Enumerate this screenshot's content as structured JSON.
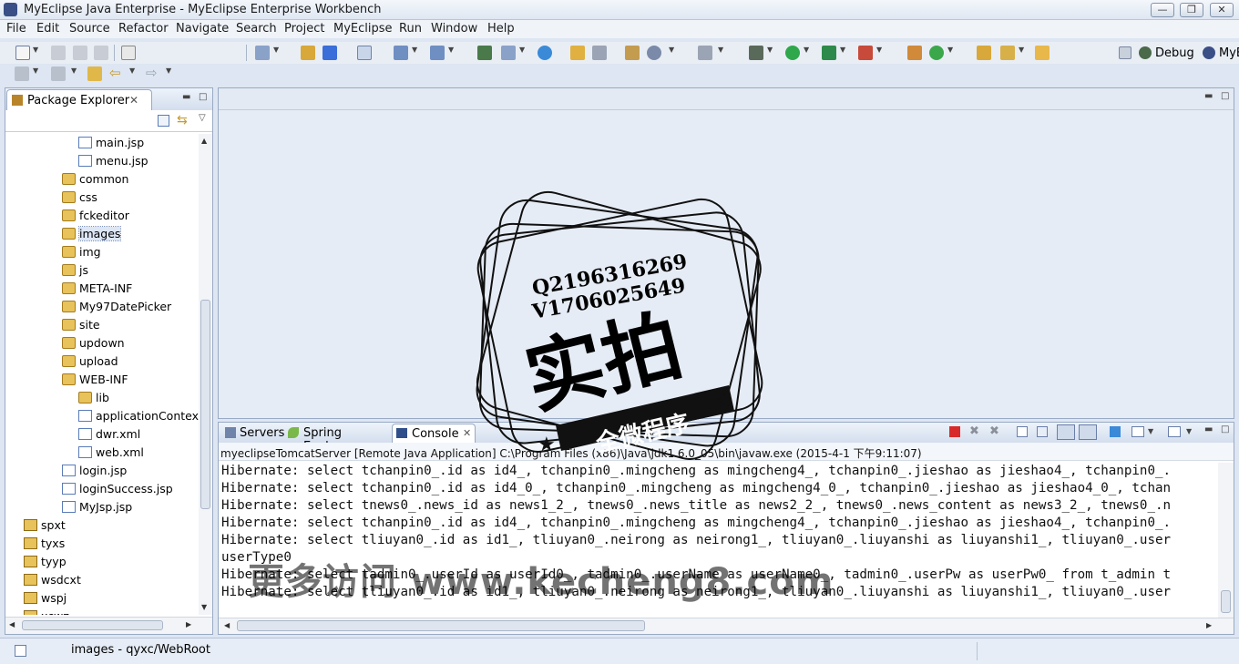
{
  "window": {
    "title": "MyEclipse Java Enterprise - MyEclipse Enterprise Workbench"
  },
  "menu": [
    "File",
    "Edit",
    "Source",
    "Refactor",
    "Navigate",
    "Search",
    "Project",
    "MyEclipse",
    "Run",
    "Window",
    "Help"
  ],
  "perspectives": {
    "debug": "Debug",
    "myeclipse": "MyE"
  },
  "package_explorer": {
    "title": "Package Explorer",
    "tree": [
      {
        "label": "main.jsp",
        "type": "file",
        "indent": 3
      },
      {
        "label": "menu.jsp",
        "type": "file",
        "indent": 3
      },
      {
        "label": "common",
        "type": "folder",
        "indent": 2
      },
      {
        "label": "css",
        "type": "folder",
        "indent": 2
      },
      {
        "label": "fckeditor",
        "type": "folder",
        "indent": 2
      },
      {
        "label": "images",
        "type": "folder",
        "indent": 2
      },
      {
        "label": "img",
        "type": "folder",
        "indent": 2
      },
      {
        "label": "js",
        "type": "folder",
        "indent": 2
      },
      {
        "label": "META-INF",
        "type": "folder",
        "indent": 2
      },
      {
        "label": "My97DatePicker",
        "type": "folder",
        "indent": 2
      },
      {
        "label": "site",
        "type": "folder",
        "indent": 2
      },
      {
        "label": "updown",
        "type": "folder",
        "indent": 2
      },
      {
        "label": "upload",
        "type": "folder",
        "indent": 2
      },
      {
        "label": "WEB-INF",
        "type": "folder",
        "indent": 2
      },
      {
        "label": "lib",
        "type": "folder",
        "indent": 3
      },
      {
        "label": "applicationContext",
        "type": "file",
        "indent": 3
      },
      {
        "label": "dwr.xml",
        "type": "file",
        "indent": 3
      },
      {
        "label": "web.xml",
        "type": "file",
        "indent": 3
      },
      {
        "label": "login.jsp",
        "type": "file",
        "indent": 2
      },
      {
        "label": "loginSuccess.jsp",
        "type": "file",
        "indent": 2
      },
      {
        "label": "MyJsp.jsp",
        "type": "file",
        "indent": 2
      },
      {
        "label": "spxt",
        "type": "proj",
        "indent": 1
      },
      {
        "label": "tyxs",
        "type": "proj",
        "indent": 1
      },
      {
        "label": "tyyp",
        "type": "proj",
        "indent": 1
      },
      {
        "label": "wsdcxt",
        "type": "proj",
        "indent": 1
      },
      {
        "label": "wspj",
        "type": "proj",
        "indent": 1
      },
      {
        "label": "xcwz",
        "type": "proj",
        "indent": 1
      }
    ],
    "selected": "images"
  },
  "console": {
    "tabs": [
      "Servers",
      "Spring Explorer",
      "Console"
    ],
    "info": "myeclipseTomcatServer [Remote Java Application] C:\\Program Files (x86)\\Java\\jdk1.6.0_05\\bin\\javaw.exe (2015-4-1 下午9:11:07)",
    "lines": [
      "Hibernate: select tchanpin0_.id as id4_, tchanpin0_.mingcheng as mingcheng4_, tchanpin0_.jieshao as jieshao4_, tchanpin0_.",
      "Hibernate: select tchanpin0_.id as id4_0_, tchanpin0_.mingcheng as mingcheng4_0_, tchanpin0_.jieshao as jieshao4_0_, tchan",
      "Hibernate: select tnews0_.news_id as news1_2_, tnews0_.news_title as news2_2_, tnews0_.news_content as news3_2_, tnews0_.n",
      "Hibernate: select tchanpin0_.id as id4_, tchanpin0_.mingcheng as mingcheng4_, tchanpin0_.jieshao as jieshao4_, tchanpin0_.",
      "Hibernate: select tliuyan0_.id as id1_, tliuyan0_.neirong as neirong1_, tliuyan0_.liuyanshi as liuyanshi1_, tliuyan0_.user",
      "userType0",
      "Hibernate: select tadmin0_.userId as userId0_, tadmin0_.userName as userName0_, tadmin0_.userPw as userPw0_ from t_admin t",
      "Hibernate: select tliuyan0_.id as id1_, tliuyan0_.neirong as neirong1_, tliuyan0_.liuyanshi as liuyanshi1_, tliuyan0_.user"
    ]
  },
  "status": {
    "text": "images - qyxc/WebRoot"
  },
  "watermark": {
    "stamp_line1": "Q2196316269",
    "stamp_line2": "V1706025649",
    "stamp_main": "实拍",
    "stamp_ribbon": "全微程序",
    "overlay": "更多访问 www.kecheng8.com"
  }
}
